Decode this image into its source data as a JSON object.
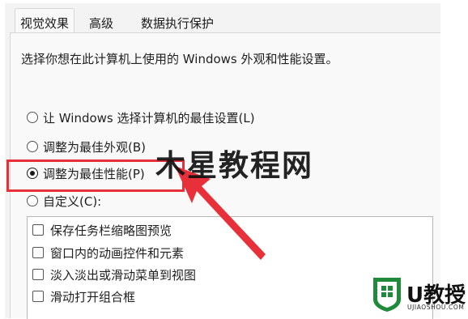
{
  "tabs": [
    {
      "label": "视觉效果",
      "active": true
    },
    {
      "label": "高级",
      "active": false
    },
    {
      "label": "数据执行保护",
      "active": false
    }
  ],
  "description": "选择你想在此计算机上使用的 Windows 外观和性能设置。",
  "radio_options": [
    {
      "label": "让 Windows 选择计算机的最佳设置(L)",
      "checked": false
    },
    {
      "label": "调整为最佳外观(B)",
      "checked": false
    },
    {
      "label": "调整为最佳性能(P)",
      "checked": true
    },
    {
      "label": "自定义(C):",
      "checked": false
    }
  ],
  "custom_effects": [
    {
      "label": "保存任务栏缩略图预览",
      "checked": false
    },
    {
      "label": "窗口内的动画控件和元素",
      "checked": false
    },
    {
      "label": "淡入淡出或滑动菜单到视图",
      "checked": false
    },
    {
      "label": "滑动打开组合框",
      "checked": false
    }
  ],
  "overlay": {
    "watermark": "木星教程网",
    "logo_text": "U教授",
    "logo_subtext": "UJIAOSHOU.COM",
    "highlight_color": "#e8303a",
    "logo_color": "#1e8a3a"
  }
}
